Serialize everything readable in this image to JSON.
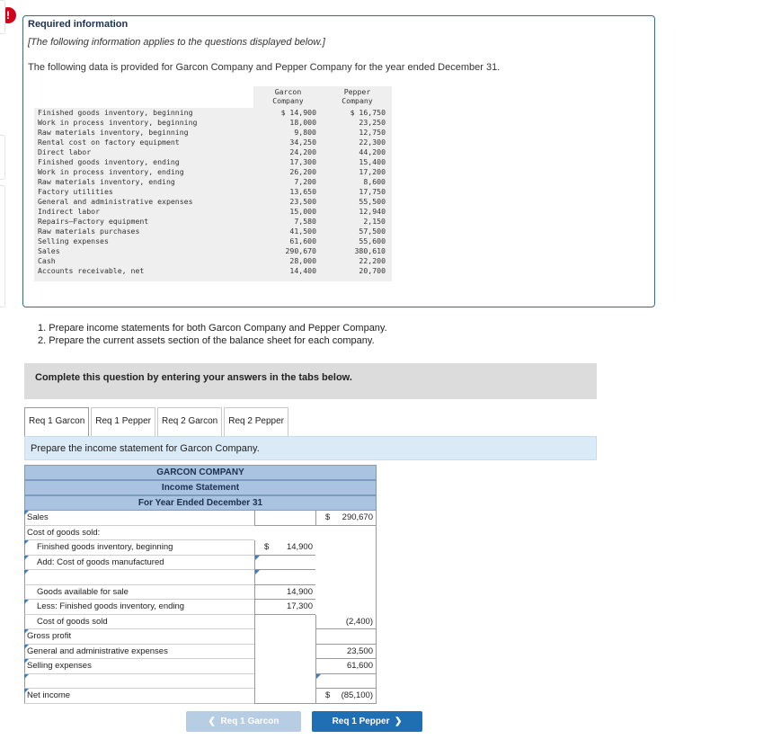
{
  "alert": "!",
  "info": {
    "title": "Required information",
    "note": "[The following information applies to the questions displayed below.]",
    "intro": "The following data is provided for Garcon Company and Pepper Company for the year ended December 31."
  },
  "data_table": {
    "col1_header_line1": "Garcon",
    "col1_header_line2": "Company",
    "col2_header_line1": "Pepper",
    "col2_header_line2": "Company",
    "rows": [
      {
        "label": "Finished goods inventory, beginning",
        "garcon": "$ 14,900",
        "pepper": "$ 16,750"
      },
      {
        "label": "Work in process inventory, beginning",
        "garcon": "18,000",
        "pepper": "23,250"
      },
      {
        "label": "Raw materials inventory, beginning",
        "garcon": "9,800",
        "pepper": "12,750"
      },
      {
        "label": "Rental cost on factory equipment",
        "garcon": "34,250",
        "pepper": "22,300"
      },
      {
        "label": "Direct labor",
        "garcon": "24,200",
        "pepper": "44,200"
      },
      {
        "label": "Finished goods inventory, ending",
        "garcon": "17,300",
        "pepper": "15,400"
      },
      {
        "label": "Work in process inventory, ending",
        "garcon": "26,200",
        "pepper": "17,200"
      },
      {
        "label": "Raw materials inventory, ending",
        "garcon": "7,200",
        "pepper": "8,600"
      },
      {
        "label": "Factory utilities",
        "garcon": "13,650",
        "pepper": "17,750"
      },
      {
        "label": "General and administrative expenses",
        "garcon": "23,500",
        "pepper": "55,500"
      },
      {
        "label": "Indirect labor",
        "garcon": "15,000",
        "pepper": "12,940"
      },
      {
        "label": "Repairs—Factory equipment",
        "garcon": "7,580",
        "pepper": "2,150"
      },
      {
        "label": "Raw materials purchases",
        "garcon": "41,500",
        "pepper": "57,500"
      },
      {
        "label": "Selling expenses",
        "garcon": "61,600",
        "pepper": "55,600"
      },
      {
        "label": "Sales",
        "garcon": "290,670",
        "pepper": "380,610"
      },
      {
        "label": "Cash",
        "garcon": "28,000",
        "pepper": "22,200"
      },
      {
        "label": "Accounts receivable, net",
        "garcon": "14,400",
        "pepper": "20,700"
      }
    ]
  },
  "instructions": {
    "line1": "1. Prepare income statements for both Garcon Company and Pepper Company.",
    "line2": "2. Prepare the current assets section of the balance sheet for each company."
  },
  "complete_bar": "Complete this question by entering your answers in the tabs below.",
  "tabs": [
    "Req 1 Garcon",
    "Req 1 Pepper",
    "Req 2 Garcon",
    "Req 2 Pepper"
  ],
  "prompt": "Prepare the income statement for Garcon Company.",
  "statement": {
    "company": "GARCON COMPANY",
    "title": "Income Statement",
    "period": "For Year Ended December 31",
    "rows": {
      "sales": {
        "label": "Sales",
        "c2_dollar": "$",
        "c2": "290,670"
      },
      "cogs_header": {
        "label": "Cost of goods sold:"
      },
      "fg_begin": {
        "label": "Finished goods inventory, beginning",
        "c1_dollar": "$",
        "c1": "14,900"
      },
      "add_cogm": {
        "label": "Add: Cost of goods manufactured"
      },
      "available": {
        "label": "Goods available for sale",
        "c1": "14,900"
      },
      "less_fg_end": {
        "label": "Less: Finished goods inventory, ending",
        "c1": "17,300"
      },
      "cogs": {
        "label": "Cost of goods sold",
        "c2": "(2,400)"
      },
      "gross_profit": {
        "label": "Gross profit"
      },
      "gen_admin": {
        "label": "General and administrative expenses",
        "c2": "23,500"
      },
      "selling": {
        "label": "Selling expenses",
        "c2": "61,600"
      },
      "net_income": {
        "label": "Net income",
        "c2_dollar": "$",
        "c2": "(85,100)"
      }
    }
  },
  "nav": {
    "prev": "Req 1 Garcon",
    "next": "Req 1 Pepper"
  },
  "colors": {
    "accent": "#1f6fb5",
    "header_fill": "#aac3e0",
    "alert": "#d0021b"
  }
}
